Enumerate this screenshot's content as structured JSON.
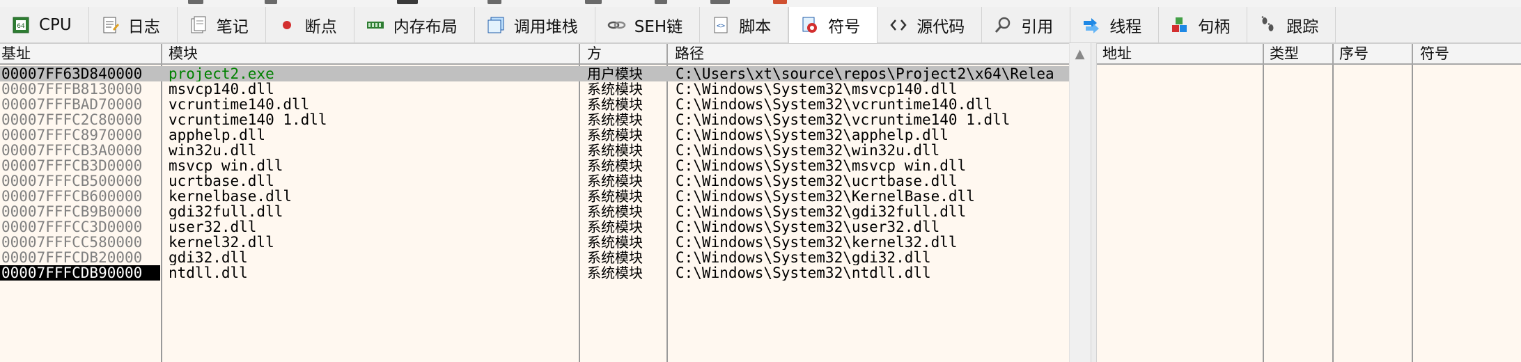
{
  "tabs": [
    {
      "label": "CPU",
      "icon": "cpu-icon"
    },
    {
      "label": "日志",
      "icon": "log-icon"
    },
    {
      "label": "笔记",
      "icon": "notes-icon"
    },
    {
      "label": "断点",
      "icon": "breakpoint-icon"
    },
    {
      "label": "内存布局",
      "icon": "memory-map-icon"
    },
    {
      "label": "调用堆栈",
      "icon": "call-stack-icon"
    },
    {
      "label": "SEH链",
      "icon": "seh-chain-icon"
    },
    {
      "label": "脚本",
      "icon": "script-icon"
    },
    {
      "label": "符号",
      "icon": "symbols-icon",
      "active": true
    },
    {
      "label": "源代码",
      "icon": "source-icon"
    },
    {
      "label": "引用",
      "icon": "references-icon"
    },
    {
      "label": "线程",
      "icon": "threads-icon"
    },
    {
      "label": "句柄",
      "icon": "handles-icon"
    },
    {
      "label": "跟踪",
      "icon": "trace-icon"
    }
  ],
  "colors": {
    "accent_green": "#008000",
    "selected_row": "#c0c0c0",
    "background": "#fff8f0"
  },
  "modules": {
    "headers": {
      "base": "基址",
      "module": "模块",
      "party": "方",
      "path": "路径"
    },
    "rows": [
      {
        "base": "00007FF63D840000",
        "module": "project2.exe",
        "party": "用户模块",
        "path": "C:\\Users\\xt\\source\\repos\\Project2\\x64\\Relea"
      },
      {
        "base": "00007FFFB8130000",
        "module": "msvcp140.dll",
        "party": "系统模块",
        "path": "C:\\Windows\\System32\\msvcp140.dll"
      },
      {
        "base": "00007FFFBAD70000",
        "module": "vcruntime140.dll",
        "party": "系统模块",
        "path": "C:\\Windows\\System32\\vcruntime140.dll"
      },
      {
        "base": "00007FFFC2C80000",
        "module": "vcruntime140_1.dll",
        "party": "系统模块",
        "path": "C:\\Windows\\System32\\vcruntime140_1.dll"
      },
      {
        "base": "00007FFFC8970000",
        "module": "apphelp.dll",
        "party": "系统模块",
        "path": "C:\\Windows\\System32\\apphelp.dll"
      },
      {
        "base": "00007FFFCB3A0000",
        "module": "win32u.dll",
        "party": "系统模块",
        "path": "C:\\Windows\\System32\\win32u.dll"
      },
      {
        "base": "00007FFFCB3D0000",
        "module": "msvcp_win.dll",
        "party": "系统模块",
        "path": "C:\\Windows\\System32\\msvcp_win.dll"
      },
      {
        "base": "00007FFFCB500000",
        "module": "ucrtbase.dll",
        "party": "系统模块",
        "path": "C:\\Windows\\System32\\ucrtbase.dll"
      },
      {
        "base": "00007FFFCB600000",
        "module": "kernelbase.dll",
        "party": "系统模块",
        "path": "C:\\Windows\\System32\\KernelBase.dll"
      },
      {
        "base": "00007FFFCB9B0000",
        "module": "gdi32full.dll",
        "party": "系统模块",
        "path": "C:\\Windows\\System32\\gdi32full.dll"
      },
      {
        "base": "00007FFFCC3D0000",
        "module": "user32.dll",
        "party": "系统模块",
        "path": "C:\\Windows\\System32\\user32.dll"
      },
      {
        "base": "00007FFFCC580000",
        "module": "kernel32.dll",
        "party": "系统模块",
        "path": "C:\\Windows\\System32\\kernel32.dll"
      },
      {
        "base": "00007FFFCDB20000",
        "module": "gdi32.dll",
        "party": "系统模块",
        "path": "C:\\Windows\\System32\\gdi32.dll"
      },
      {
        "base": "00007FFFCDB90000",
        "module": "ntdll.dll",
        "party": "系统模块",
        "path": "C:\\Windows\\System32\\ntdll.dll"
      }
    ]
  },
  "symbols": {
    "headers": {
      "address": "地址",
      "type": "类型",
      "ordinal": "序号",
      "symbol": "符号"
    }
  }
}
